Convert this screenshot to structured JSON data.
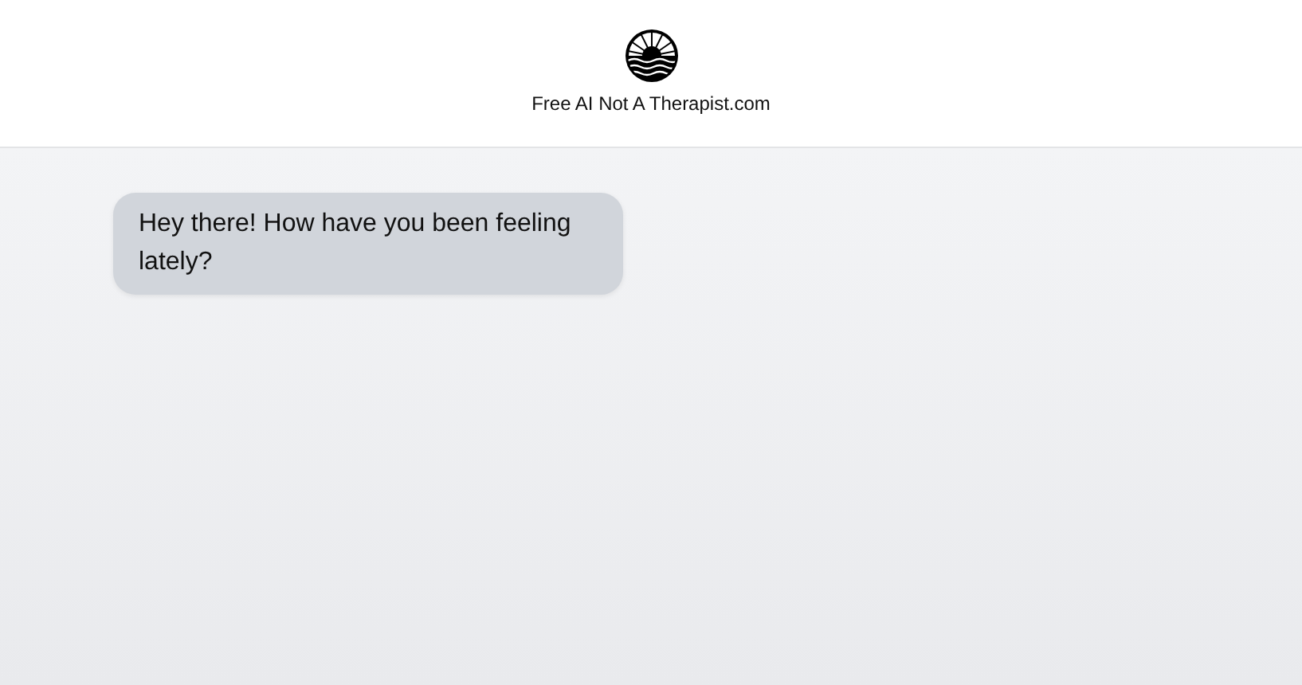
{
  "header": {
    "site_name": "Free AI Not A Therapist.com"
  },
  "messages": [
    {
      "kind": "bot",
      "text": "Hey there! How have you been feeling lately?"
    }
  ]
}
